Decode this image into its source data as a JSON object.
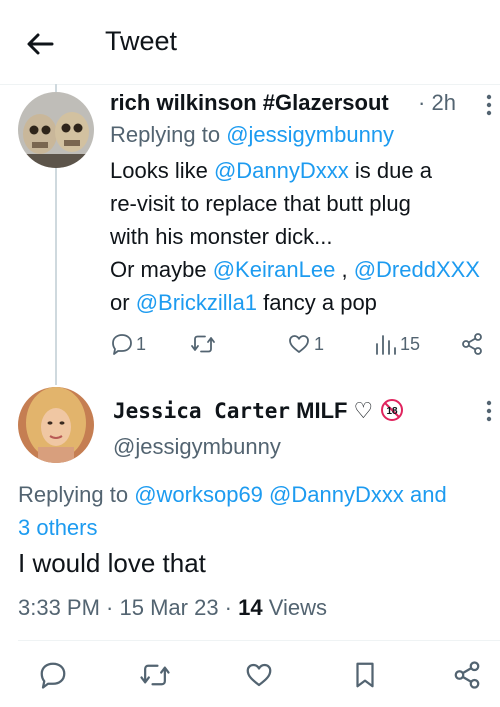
{
  "header": {
    "title": "Tweet",
    "back_icon": "arrow-left-icon"
  },
  "reply": {
    "author_name": "rich wilkinson #Glazersout",
    "time": "2h",
    "replying_prefix": "Replying to",
    "replying_handle": "@jessigymbunny",
    "lines": {
      "l1_a": "Looks like ",
      "l1_b": "@DannyDxxx",
      "l1_c": " is due a",
      "l2": "re-visit to replace that butt plug",
      "l3": "with his monster dick...",
      "l4_a": "Or maybe ",
      "l4_b": "@KeiranLee",
      "l4_c": " , ",
      "l4_d": "@DreddXXX",
      "l5_a": "or ",
      "l5_b": "@Brickzilla1",
      "l5_c": " fancy a pop"
    },
    "actions": {
      "reply_count": "1",
      "retweet_count": "",
      "like_count": "1",
      "views_count": "15"
    }
  },
  "main": {
    "display_name": "Jessica Carter",
    "name_suffix": " MILF ♡",
    "handle": "@jessigymbunny",
    "replying_prefix": "Replying to ",
    "replying_h1": "@worksop69",
    "replying_h2": " @DannyDxxx",
    "replying_and": " and",
    "replying_others": "3 others",
    "text": "I would love that",
    "time": "3:33 PM",
    "dot1": " · ",
    "date": "15 Mar 23",
    "dot2": " · ",
    "views_num": "14",
    "views_label": " Views"
  },
  "badge": {
    "label": "18"
  },
  "colors": {
    "accent": "#1d9bf0",
    "muted": "#536471",
    "text": "#0f1419",
    "badge": "#e0245e"
  }
}
